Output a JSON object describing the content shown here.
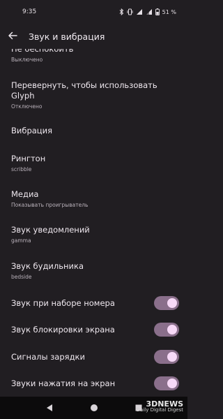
{
  "status": {
    "time": "9:35",
    "battery": "51 %"
  },
  "header": {
    "title": "Звук и вибрация"
  },
  "list": [
    {
      "title": "Не беспокоить",
      "subtitle": "Выключено"
    },
    {
      "title": "Перевернуть, чтобы использовать Glyph",
      "subtitle": "Отключено"
    },
    {
      "title": "Вибрация"
    },
    {
      "title": "Рингтон",
      "subtitle": "scribble"
    },
    {
      "title": "Медиа",
      "subtitle": "Показывать проигрыватель"
    },
    {
      "title": "Звук уведомлений",
      "subtitle": "gamma"
    },
    {
      "title": "Звук будильника",
      "subtitle": "bedside"
    }
  ],
  "toggles": [
    {
      "title": "Звук при наборе номера",
      "on": true
    },
    {
      "title": "Звук блокировки экрана",
      "on": true
    },
    {
      "title": "Сигналы зарядки",
      "on": true
    },
    {
      "title": "Звуки нажатия на экран",
      "on": true
    }
  ],
  "watermark": {
    "brand": "3DNEWS",
    "tagline": "Daily Digital Digest"
  },
  "colors": {
    "background": "#211e22",
    "switch_track": "#8a6f8b",
    "switch_thumb": "#f7d9f7"
  }
}
